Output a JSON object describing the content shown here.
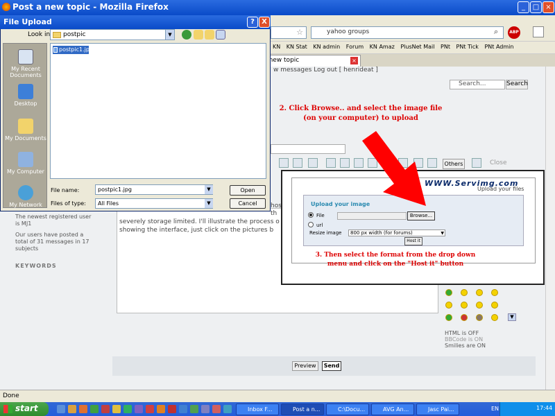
{
  "firefox": {
    "title": "Post a new topic - Mozilla Firefox",
    "search_text": "yahoo groups",
    "search_engine_icon": "G",
    "adblock_label": "ABP",
    "bookmarks": [
      "KN",
      "KN Stat",
      "KN admin",
      "Forum",
      "KN Amaz",
      "PlusNet Mail",
      "PNt",
      "PNt Tick",
      "PNt Admin"
    ],
    "tab_label": "n new topic",
    "status": "Done"
  },
  "forum": {
    "top_strip": "w messages  Log out [ henrideat ]",
    "search_placeholder": "Search...",
    "search_button": "Search",
    "annotation_2_line1": "2. Click Browse.. and select the image file",
    "annotation_2_line2": "(on your computer) to upload",
    "others_button": "Others",
    "close_label": "Close",
    "stats_line1": "The newest registered user",
    "stats_line2": "is MJ1",
    "stats_line3": "Our users have posted a",
    "stats_line4": "total of 31 messages in 17",
    "stats_line5": "subjects",
    "keywords": "KEYWORDS",
    "msg_line1": "th",
    "msg_line2": "severely storage limited. I'll illustrate the process o",
    "msg_line3": "showing the interface, just click on the pictures b",
    "msg_frag": "hos",
    "html_status": "HTML is OFF",
    "bbcode_status": "BBCode is ON",
    "smilies_status": "Smilies are ON",
    "preview_button": "Preview",
    "send_button": "Send"
  },
  "servimg": {
    "logo": "WWW.Servimg.com",
    "tagline": "Upload your files",
    "upload_title": "Upload your image",
    "file_option": "File",
    "url_option": "url",
    "browse_button": "Browse...",
    "resize_label": "Resize image",
    "resize_value": "800 px width (for forums)",
    "host_button": "Host it",
    "annotation_3_line1": "3. Then select the format from the drop down",
    "annotation_3_line2": "menu and click on the \"Host it\" button"
  },
  "dialog": {
    "title": "File Upload",
    "help": "?",
    "close": "X",
    "look_in_label": "Look in:",
    "look_in_value": "postpic",
    "places": [
      "My Recent Documents",
      "Desktop",
      "My Documents",
      "My Computer",
      "My Network"
    ],
    "file_item": "postpic1.jpg",
    "file_name_label": "File name:",
    "file_name_value": "postpic1.jpg",
    "file_type_label": "Files of type:",
    "file_type_value": "All Files",
    "open_button": "Open",
    "cancel_button": "Cancel"
  },
  "taskbar": {
    "start": "start",
    "buttons": [
      "Inbox F...",
      "Post a n...",
      "C:\\Docu...",
      "AVG An...",
      "Jasc Pai..."
    ],
    "lang": "EN",
    "clock": "17:44"
  },
  "colors": {
    "xp_blue": "#0A4BC8",
    "annotation_red": "#DD0000",
    "selection": "#316AC5"
  }
}
